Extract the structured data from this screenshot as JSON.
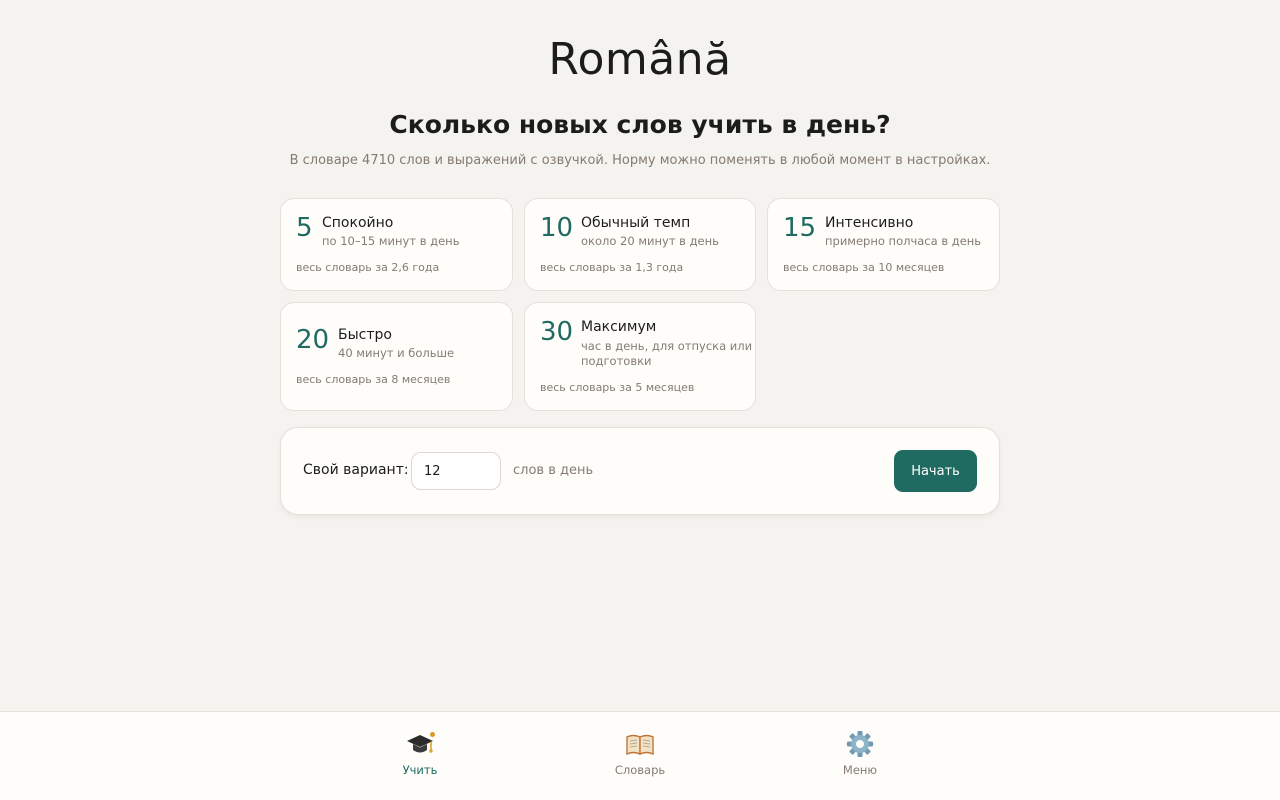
{
  "app_title": "Română",
  "question": "Сколько новых слов учить в день?",
  "subtitle": "В словаре 4710 слов и выражений с озвучкой. Норму можно поменять в любой момент в настройках.",
  "plans": [
    {
      "number": "5",
      "name": "Спокойно",
      "desc": "по 10–15 минут в день",
      "foot": "весь словарь за 2,6 года"
    },
    {
      "number": "10",
      "name": "Обычный темп",
      "desc": "около 20 минут в день",
      "foot": "весь словарь за 1,3 года"
    },
    {
      "number": "15",
      "name": "Интенсивно",
      "desc": "примерно полчаса в день",
      "foot": "весь словарь за 10 месяцев"
    },
    {
      "number": "20",
      "name": "Быстро",
      "desc": "40 минут и больше",
      "foot": "весь словарь за 8 месяцев"
    },
    {
      "number": "30",
      "name": "Максимум",
      "desc_line1": "час в день, для отпуска или",
      "desc_line2": "подготовки",
      "foot": "весь словарь за 5 месяцев"
    }
  ],
  "custom": {
    "label": "Свой вариант:",
    "value": "12",
    "unit": "слов в день",
    "start_label": "Начать"
  },
  "nav": [
    {
      "label": "Учить",
      "icon": "graduation-cap-icon",
      "active": true
    },
    {
      "label": "Словарь",
      "icon": "open-book-icon",
      "active": false
    },
    {
      "label": "Меню",
      "icon": "gear-icon",
      "active": false
    }
  ],
  "colors": {
    "accent": "#1f6b62",
    "background": "#f4f3ef",
    "card": "#fefdfa",
    "muted_text": "#857b72",
    "notification_dot": "#d99a2b"
  }
}
